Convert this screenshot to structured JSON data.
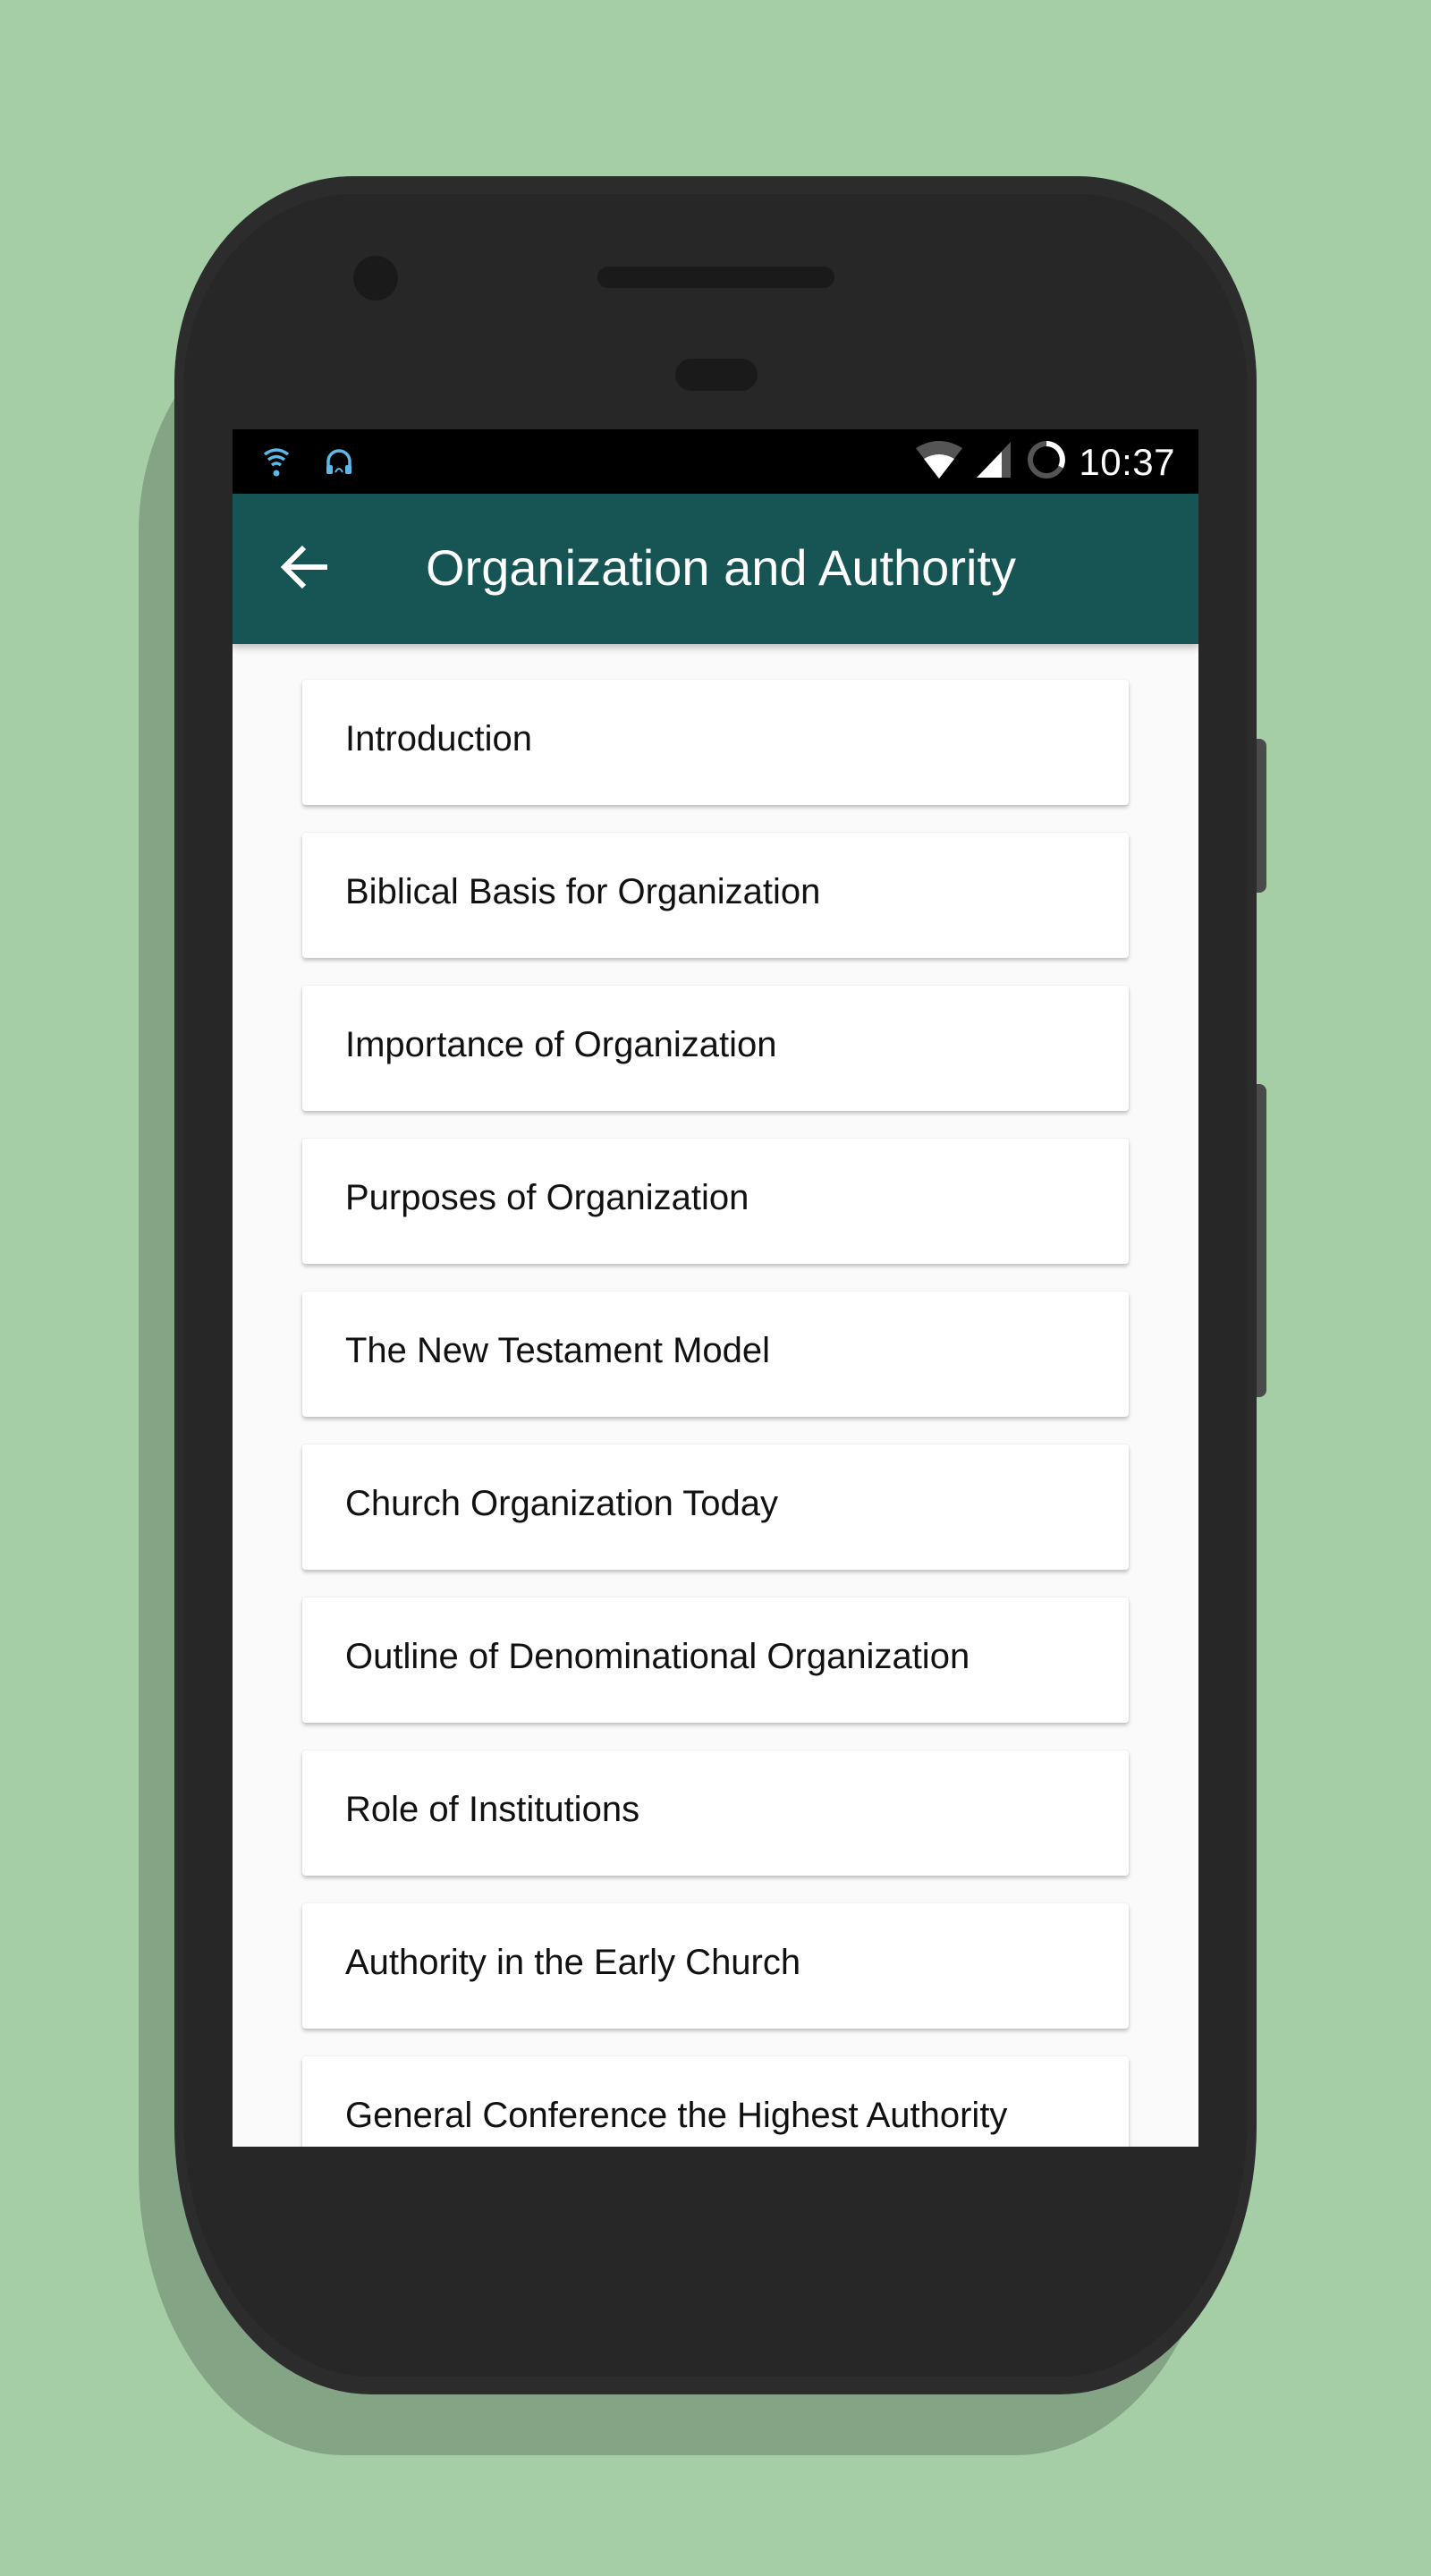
{
  "status_bar": {
    "left_icons": [
      "wifi-signal-icon",
      "headphones-icon"
    ],
    "right_icons": [
      "wifi-icon",
      "cell-signal-icon",
      "battery-ring-icon"
    ],
    "time": "10:37",
    "accent_color": "#5bb8e8"
  },
  "app_bar": {
    "back_icon": "arrow-left-icon",
    "title": "Organization and Authority",
    "color": "#175454"
  },
  "topics": [
    {
      "label": "Introduction"
    },
    {
      "label": "Biblical Basis for Organization"
    },
    {
      "label": "Importance of Organization"
    },
    {
      "label": "Purposes of Organization"
    },
    {
      "label": "The New Testament Model"
    },
    {
      "label": "Church Organization Today"
    },
    {
      "label": "Outline of Denominational Organization"
    },
    {
      "label": "Role of Institutions"
    },
    {
      "label": "Authority in the Early Church"
    },
    {
      "label": "General Conference the Highest Authority"
    }
  ]
}
